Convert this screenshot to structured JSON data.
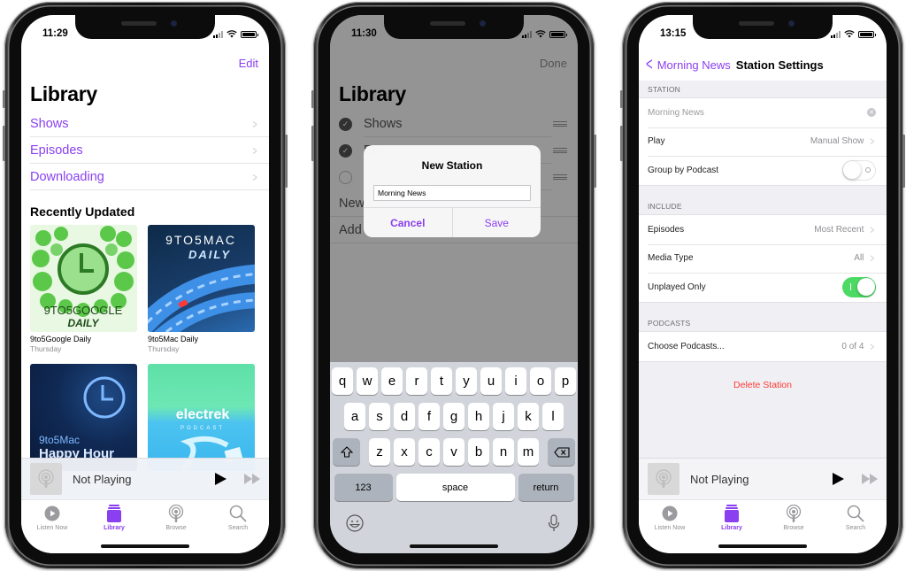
{
  "accent_color": "#8a3ff0",
  "phones": {
    "library": {
      "status_time": "11:29",
      "edit_label": "Edit",
      "title": "Library",
      "rows": [
        {
          "label": "Shows"
        },
        {
          "label": "Episodes"
        },
        {
          "label": "Downloading"
        }
      ],
      "section_title": "Recently Updated",
      "podcasts": [
        {
          "title": "9to5Google Daily",
          "subtitle": "Thursday",
          "art_text_1": "9TO5GOOGLE",
          "art_text_2": "DAILY"
        },
        {
          "title": "9to5Mac Daily",
          "subtitle": "Thursday",
          "art_text_1": "9TO5MAC",
          "art_text_2": "DAILY"
        },
        {
          "title": "",
          "subtitle": "",
          "art_text_1": "9to5Mac",
          "art_text_2": "Happy Hour"
        },
        {
          "title": "",
          "subtitle": "",
          "art_text_1": "electrek",
          "art_text_2": "PODCAST"
        }
      ]
    },
    "new_station": {
      "status_time": "11:30",
      "done_label": "Done",
      "title": "Library",
      "rows": [
        {
          "label": "Shows",
          "checked": true
        },
        {
          "label": "Ep",
          "checked": true
        },
        {
          "label": "",
          "checked": false
        }
      ],
      "extra_rows": [
        {
          "label": "New"
        },
        {
          "label": "Add"
        }
      ],
      "alert": {
        "title": "New Station",
        "input_value": "Morning News",
        "cancel_label": "Cancel",
        "save_label": "Save"
      },
      "keyboard": {
        "row1": [
          "q",
          "w",
          "e",
          "r",
          "t",
          "y",
          "u",
          "i",
          "o",
          "p"
        ],
        "row2": [
          "a",
          "s",
          "d",
          "f",
          "g",
          "h",
          "j",
          "k",
          "l"
        ],
        "row3": [
          "z",
          "x",
          "c",
          "v",
          "b",
          "n",
          "m"
        ],
        "numbers_label": "123",
        "space_label": "space",
        "return_label": "return"
      }
    },
    "station_settings": {
      "status_time": "13:15",
      "back_label": "Morning News",
      "title": "Station Settings",
      "station_header": "STATION",
      "station_name": "Morning News",
      "play_label": "Play",
      "play_value": "Manual Show",
      "group_label": "Group by Podcast",
      "group_on": false,
      "include_header": "INCLUDE",
      "episodes_label": "Episodes",
      "episodes_value": "Most Recent",
      "media_label": "Media Type",
      "media_value": "All",
      "unplayed_label": "Unplayed Only",
      "unplayed_on": true,
      "podcasts_header": "PODCASTS",
      "choose_label": "Choose Podcasts...",
      "choose_value": "0 of 4",
      "delete_label": "Delete Station"
    }
  },
  "mini_player": {
    "title": "Not Playing"
  },
  "tabbar": [
    {
      "label": "Listen Now",
      "icon": "play-circle-icon"
    },
    {
      "label": "Library",
      "icon": "library-stack-icon",
      "active": true
    },
    {
      "label": "Browse",
      "icon": "podcast-icon"
    },
    {
      "label": "Search",
      "icon": "search-icon"
    }
  ]
}
